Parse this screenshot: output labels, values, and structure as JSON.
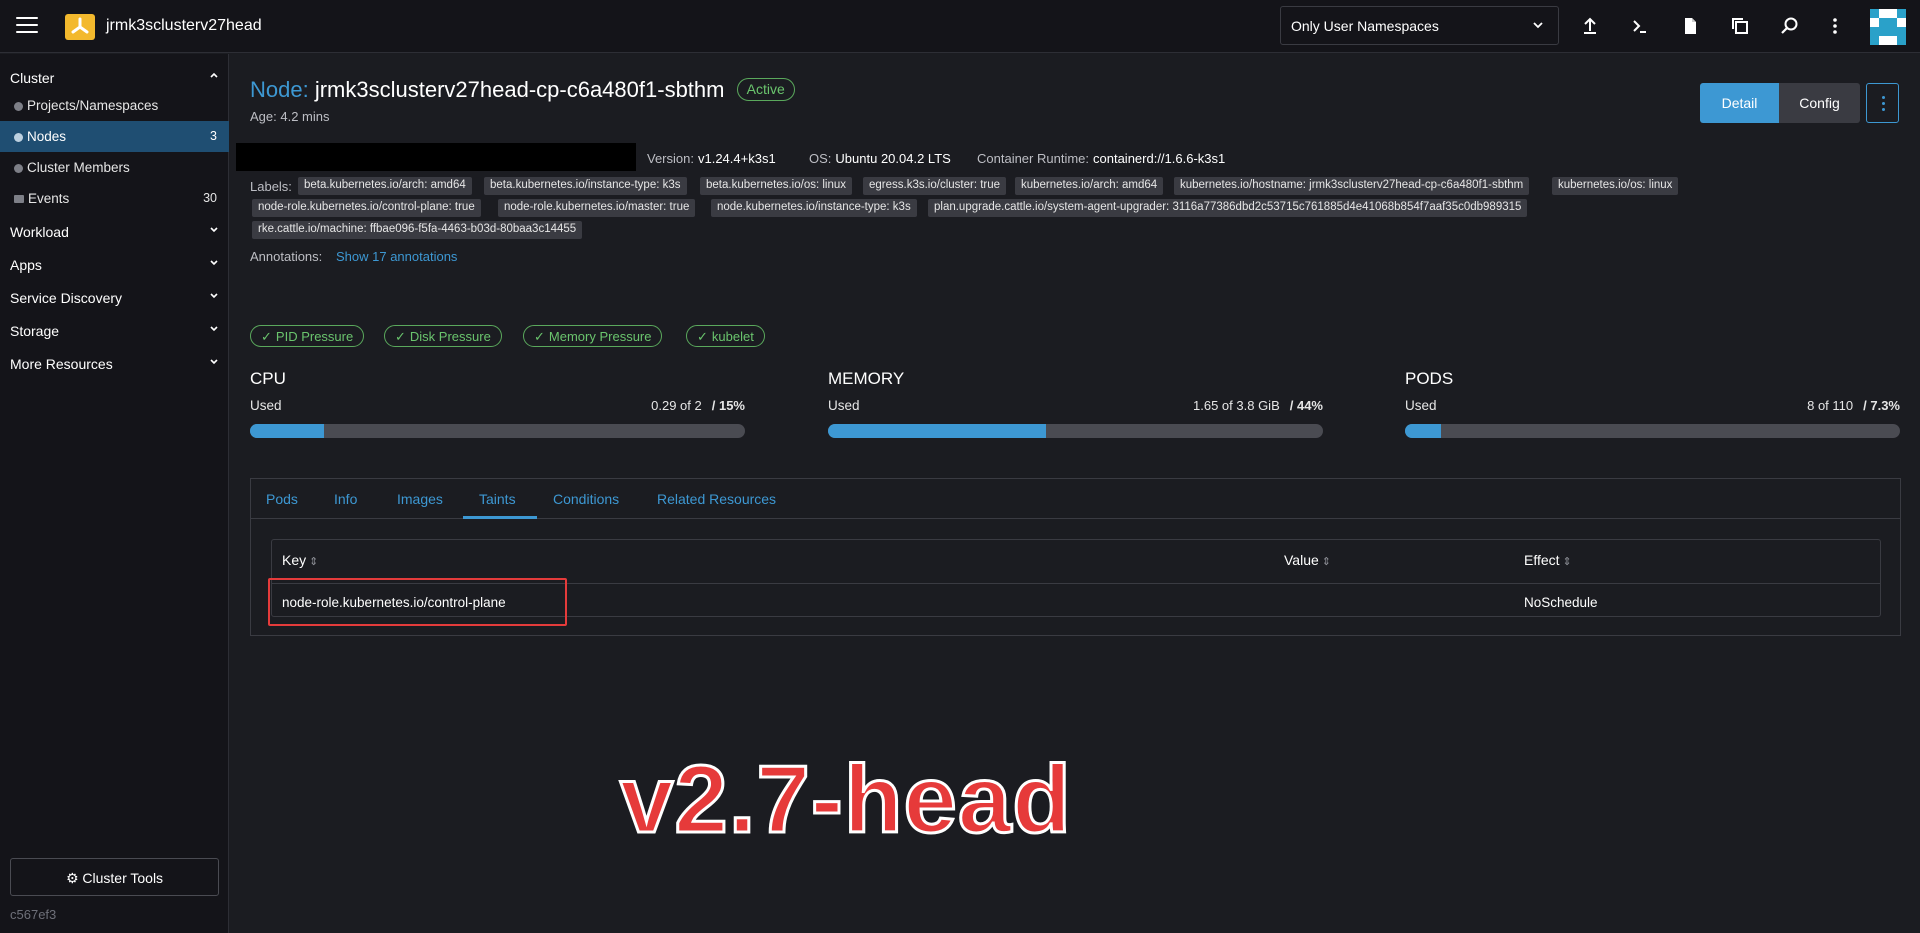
{
  "header": {
    "cluster_name": "jrmk3sclusterv27head",
    "namespace_filter": "Only User Namespaces"
  },
  "sidebar": {
    "groups": [
      {
        "label": "Cluster"
      },
      {
        "label": "Workload"
      },
      {
        "label": "Apps"
      },
      {
        "label": "Service Discovery"
      },
      {
        "label": "Storage"
      },
      {
        "label": "More Resources"
      }
    ],
    "items": [
      {
        "label": "Projects/Namespaces",
        "count": ""
      },
      {
        "label": "Nodes",
        "count": "3"
      },
      {
        "label": "Cluster Members",
        "count": ""
      },
      {
        "label": "Events",
        "count": "30"
      }
    ],
    "tools_label": "Cluster Tools",
    "version": "c567ef3"
  },
  "node": {
    "prefix": "Node:",
    "name": "jrmk3sclusterv27head-cp-c6a480f1-sbthm",
    "state": "Active",
    "age": "Age: 4.2 mins",
    "version_label": "Version:",
    "version": "v1.24.4+k3s1",
    "os_label": "OS:",
    "os": "Ubuntu 20.04.2 LTS",
    "runtime_label": "Container Runtime:",
    "runtime": "containerd://1.6.6-k3s1"
  },
  "actions": {
    "detail": "Detail",
    "config": "Config"
  },
  "labels_title": "Labels:",
  "labels": [
    "beta.kubernetes.io/arch: amd64",
    "beta.kubernetes.io/instance-type: k3s",
    "beta.kubernetes.io/os: linux",
    "egress.k3s.io/cluster: true",
    "kubernetes.io/arch: amd64",
    "kubernetes.io/hostname: jrmk3sclusterv27head-cp-c6a480f1-sbthm",
    "kubernetes.io/os: linux",
    "node-role.kubernetes.io/control-plane: true",
    "node-role.kubernetes.io/master: true",
    "node.kubernetes.io/instance-type: k3s",
    "plan.upgrade.cattle.io/system-agent-upgrader: 3116a77386dbd2c53715c761885d4e41068b854f7aaf35c0db989315",
    "rke.cattle.io/machine: ffbae096-f5fa-4463-b03d-80baa3c14455"
  ],
  "annotations": {
    "label": "Annotations:",
    "link": "Show 17 annotations"
  },
  "conditions": [
    "PID Pressure",
    "Disk Pressure",
    "Memory Pressure",
    "kubelet"
  ],
  "gauges": [
    {
      "title": "CPU",
      "used_label": "Used",
      "amount": "0.29 of 2",
      "percent": "/ 15%",
      "fraction": 0.15
    },
    {
      "title": "MEMORY",
      "used_label": "Used",
      "amount": "1.65 of 3.8 GiB",
      "percent": "/ 44%",
      "fraction": 0.44
    },
    {
      "title": "PODS",
      "used_label": "Used",
      "amount": "8 of 110",
      "percent": "/ 7.3%",
      "fraction": 0.073
    }
  ],
  "tabs": [
    "Pods",
    "Info",
    "Images",
    "Taints",
    "Conditions",
    "Related Resources"
  ],
  "taints_table": {
    "columns": [
      "Key",
      "Value",
      "Effect"
    ],
    "rows": [
      {
        "key": "node-role.kubernetes.io/control-plane",
        "value": "",
        "effect": "NoSchedule"
      }
    ]
  },
  "overlay_text": "v2.7-head",
  "colors": {
    "accent": "#3d98d3",
    "success": "#6ac46d",
    "highlight": "#e53b3b"
  }
}
